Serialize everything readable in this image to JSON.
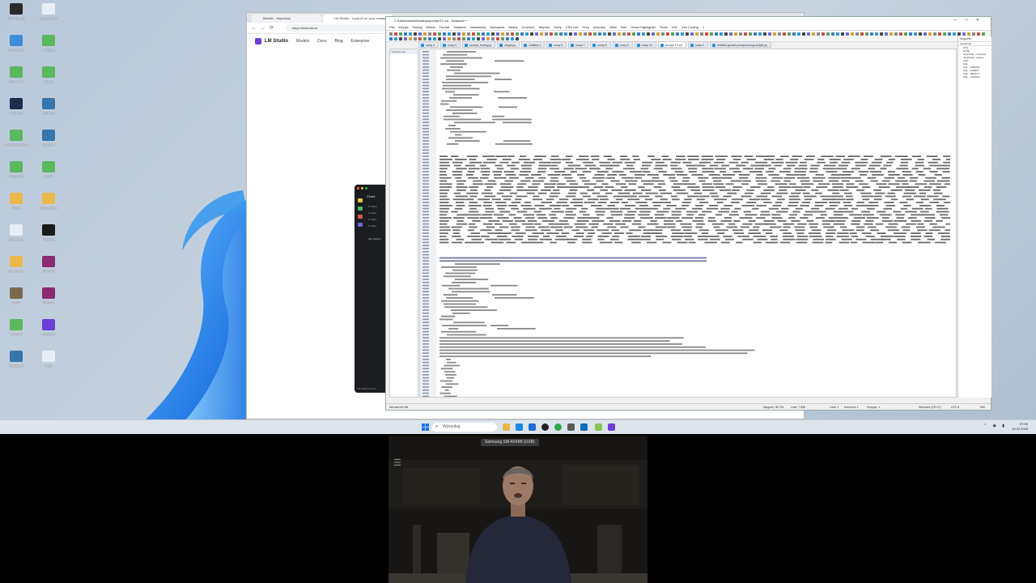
{
  "desktop": {
    "icons": [
      {
        "label": "OBS Studio",
        "color": "#2b2b2b"
      },
      {
        "label": "Recycle Bin",
        "color": "#e8eef4"
      },
      {
        "label": "Autoclicker",
        "color": "#3a8fd8"
      },
      {
        "label": "notepad",
        "color": "#5cb85c"
      },
      {
        "label": "Sterowniki",
        "color": "#5cb85c"
      },
      {
        "label": "skrypt",
        "color": "#5cb85c"
      },
      {
        "label": "IrfanView",
        "color": "#1e2b4a"
      },
      {
        "label": "script.py",
        "color": "#3776ab"
      },
      {
        "label": "Obszar roboczy",
        "color": "#5cb85c"
      },
      {
        "label": "skrypt.py",
        "color": "#3776ab"
      },
      {
        "label": "nowy plik",
        "color": "#5cb85c"
      },
      {
        "label": "plik.txt",
        "color": "#5cb85c"
      },
      {
        "label": "Folder",
        "color": "#e8b84a"
      },
      {
        "label": "Nowy folder",
        "color": "#e8b84a"
      },
      {
        "label": "Ustawienia",
        "color": "#e8eef4"
      },
      {
        "label": "Terminal",
        "color": "#1a1a1a"
      },
      {
        "label": "Dokumenty",
        "color": "#e8b84a"
      },
      {
        "label": "WinRAR",
        "color": "#8b2a6e"
      },
      {
        "label": "GIMP",
        "color": "#7a6a50"
      },
      {
        "label": "WinRAR",
        "color": "#8b2a6e"
      },
      {
        "label": "nowy.txt",
        "color": "#5cb85c"
      },
      {
        "label": "LM Studio",
        "color": "#6b3fd6"
      },
      {
        "label": "skrypt2.py",
        "color": "#3776ab"
      },
      {
        "label": "Kosz",
        "color": "#e8eef4"
      }
    ]
  },
  "browser": {
    "tabs": [
      {
        "label": "Metallo - Wyszukaj"
      },
      {
        "label": "LM Studio - Local AI on your computer"
      }
    ],
    "url": "https://lmstudio.ai",
    "nav_back": "←",
    "nav_forward": "→",
    "nav_reload": "⟳",
    "site": {
      "brand": "LM Studio",
      "links": [
        "Models",
        "Docs",
        "Blog",
        "Enterprise"
      ]
    }
  },
  "lm_app": {
    "pane_title": "Chats",
    "chats": [
      "Ct Seco",
      "Ct docs",
      "Ct docs",
      "Ct docs"
    ],
    "file_system": "File System",
    "version": "LM Studio 0.3.24"
  },
  "npp": {
    "title": "C:\\Users\\lasek\\Desktop\\prompt\\TC.txt - Notepad++",
    "menu": [
      "Plik",
      "Edycja",
      "Szukaj",
      "Widok",
      "Format",
      "Składnia",
      "Ustawienia",
      "Narzędzia",
      "Makra",
      "Uruchom",
      "Wtyczki",
      "Karty",
      "CSS Lint",
      "Prep",
      "Includes",
      "XMnl",
      "Run",
      "Smart Highlighter",
      "Tools",
      "XSL",
      "Zen Coding",
      "?"
    ],
    "doc_tabs": [
      "nowy 4",
      "nowy 5",
      "prompt_tuning.py",
      "skrypt.py",
      "Untitled-1",
      "nowy 3",
      "nowy 7",
      "nowy 8",
      "nowy 9",
      "nowy 10",
      "prompt TC.txt",
      "nowy 2",
      "Untitled-gemini-prompt-tuning-scripts.py"
    ],
    "active_tab": "prompt TC.txt",
    "left_panel_title": "Function List",
    "right_panel": {
      "title": "Snippets",
      "select": "JavaScript",
      "items": [
        "CSS",
        "HTML",
        "JavaScript - Libraries",
        "JavaScript - jQuery",
        "PHP",
        "SQL",
        "SQL - CREATE",
        "SQL - INSERT",
        "SQL - SELECT",
        "SQL - UPDATE"
      ]
    },
    "status": {
      "lang": "Normal text file",
      "length": "Długość: 38 726",
      "lines": "Linie: 7 836",
      "ln": "Linia: 1",
      "col": "Kolumna: 1",
      "pos": "Pozycja: 1",
      "eol": "Windows (CR LF)",
      "enc": "UTF-8",
      "ins": "INS"
    }
  },
  "taskbar": {
    "search_placeholder": "Wyszukaj",
    "time": "07:59",
    "date": "19.02.2026"
  },
  "webcam": {
    "device": "Samsung SM-A546B (USB)"
  }
}
